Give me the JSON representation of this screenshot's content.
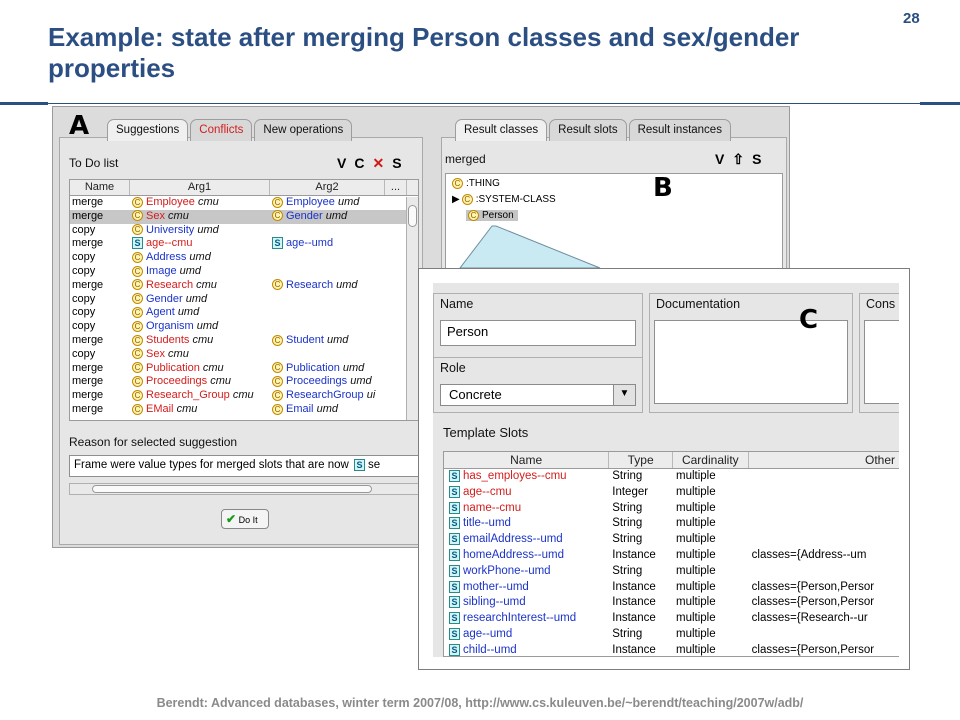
{
  "slide": {
    "title": "Example: state after merging Person classes and sex/gender properties",
    "page_number": "28",
    "footer": "Berendt: Advanced databases, winter term 2007/08, http://www.cs.kuleuven.be/~berendt/teaching/2007w/adb/"
  },
  "colors": {
    "title": "#2b4f82",
    "cmu_red": "#d41d1d",
    "umd_blue": "#1b33c9",
    "selected_row": "#c7c7c7"
  },
  "panel_a": {
    "marker": "A",
    "tabs": [
      "Suggestions",
      "Conflicts",
      "New operations"
    ],
    "active_tab": "Suggestions",
    "todo_label": "To Do list",
    "toolbar_icons": [
      "V",
      "C",
      "✕",
      "S"
    ],
    "columns": [
      "Name",
      "Arg1",
      "Arg2",
      "..."
    ],
    "rows": [
      {
        "op": "merge",
        "a1_icon": "C",
        "a1": "Employee",
        "a1_src": "cmu",
        "a2_icon": "C",
        "a2": "Employee",
        "a2_src": "umd"
      },
      {
        "op": "merge",
        "a1_icon": "C",
        "a1": "Sex",
        "a1_src": "cmu",
        "a2_icon": "C",
        "a2": "Gender",
        "a2_src": "umd",
        "selected": true
      },
      {
        "op": "copy",
        "a1_icon": "C",
        "a1": "University",
        "a1_src": "umd",
        "a2_icon": "",
        "a2": "",
        "a2_src": ""
      },
      {
        "op": "merge",
        "a1_icon": "S",
        "a1": "age--cmu",
        "a1_src": "",
        "a2_icon": "S",
        "a2": "age--umd",
        "a2_src": ""
      },
      {
        "op": "copy",
        "a1_icon": "C",
        "a1": "Address",
        "a1_src": "umd",
        "a2_icon": "",
        "a2": "",
        "a2_src": ""
      },
      {
        "op": "copy",
        "a1_icon": "C",
        "a1": "Image",
        "a1_src": "umd",
        "a2_icon": "",
        "a2": "",
        "a2_src": ""
      },
      {
        "op": "merge",
        "a1_icon": "C",
        "a1": "Research",
        "a1_src": "cmu",
        "a2_icon": "C",
        "a2": "Research",
        "a2_src": "umd"
      },
      {
        "op": "copy",
        "a1_icon": "C",
        "a1": "Gender",
        "a1_src": "umd",
        "a2_icon": "",
        "a2": "",
        "a2_src": ""
      },
      {
        "op": "copy",
        "a1_icon": "C",
        "a1": "Agent",
        "a1_src": "umd",
        "a2_icon": "",
        "a2": "",
        "a2_src": ""
      },
      {
        "op": "copy",
        "a1_icon": "C",
        "a1": "Organism",
        "a1_src": "umd",
        "a2_icon": "",
        "a2": "",
        "a2_src": ""
      },
      {
        "op": "merge",
        "a1_icon": "C",
        "a1": "Students",
        "a1_src": "cmu",
        "a2_icon": "C",
        "a2": "Student",
        "a2_src": "umd"
      },
      {
        "op": "copy",
        "a1_icon": "C",
        "a1": "Sex",
        "a1_src": "cmu",
        "a2_icon": "",
        "a2": "",
        "a2_src": ""
      },
      {
        "op": "merge",
        "a1_icon": "C",
        "a1": "Publication",
        "a1_src": "cmu",
        "a2_icon": "C",
        "a2": "Publication",
        "a2_src": "umd"
      },
      {
        "op": "merge",
        "a1_icon": "C",
        "a1": "Proceedings",
        "a1_src": "cmu",
        "a2_icon": "C",
        "a2": "Proceedings",
        "a2_src": "umd"
      },
      {
        "op": "merge",
        "a1_icon": "C",
        "a1": "Research_Group",
        "a1_src": "cmu",
        "a2_icon": "C",
        "a2": "ResearchGroup",
        "a2_src": "ui"
      },
      {
        "op": "merge",
        "a1_icon": "C",
        "a1": "EMail",
        "a1_src": "cmu",
        "a2_icon": "C",
        "a2": "Email",
        "a2_src": "umd"
      }
    ],
    "reason_label": "Reason for selected suggestion",
    "reason_text": "Frame were value types for merged slots that are now",
    "reason_tail": "se",
    "doit_label": "Do It"
  },
  "panel_b": {
    "marker": "B",
    "tabs": [
      "Result classes",
      "Result slots",
      "Result instances"
    ],
    "active_tab": "Result classes",
    "label": "merged",
    "toolbar_icons": [
      "V",
      "⇧",
      "S"
    ],
    "tree": [
      ":THING",
      ":SYSTEM-CLASS",
      "Person"
    ]
  },
  "panel_c": {
    "marker": "C",
    "name_label": "Name",
    "name_value": "Person",
    "documentation_label": "Documentation",
    "constraints_label": "Cons",
    "role_label": "Role",
    "role_value": "Concrete",
    "template_slots_label": "Template Slots",
    "columns": [
      "Name",
      "Type",
      "Cardinality",
      "Other"
    ],
    "slots": [
      {
        "name": "has_employes--cmu",
        "src": "cmu",
        "type": "String",
        "card": "multiple",
        "other": ""
      },
      {
        "name": "age--cmu",
        "src": "cmu",
        "type": "Integer",
        "card": "multiple",
        "other": ""
      },
      {
        "name": "name--cmu",
        "src": "cmu",
        "type": "String",
        "card": "multiple",
        "other": ""
      },
      {
        "name": "title--umd",
        "src": "umd",
        "type": "String",
        "card": "multiple",
        "other": ""
      },
      {
        "name": "emailAddress--umd",
        "src": "umd",
        "type": "String",
        "card": "multiple",
        "other": ""
      },
      {
        "name": "homeAddress--umd",
        "src": "umd",
        "type": "Instance",
        "card": "multiple",
        "other": "classes={Address--um"
      },
      {
        "name": "workPhone--umd",
        "src": "umd",
        "type": "String",
        "card": "multiple",
        "other": ""
      },
      {
        "name": "mother--umd",
        "src": "umd",
        "type": "Instance",
        "card": "multiple",
        "other": "classes={Person,Persor"
      },
      {
        "name": "sibling--umd",
        "src": "umd",
        "type": "Instance",
        "card": "multiple",
        "other": "classes={Person,Persor"
      },
      {
        "name": "researchInterest--umd",
        "src": "umd",
        "type": "Instance",
        "card": "multiple",
        "other": "classes={Research--ur"
      },
      {
        "name": "age--umd",
        "src": "umd",
        "type": "String",
        "card": "multiple",
        "other": ""
      },
      {
        "name": "child--umd",
        "src": "umd",
        "type": "Instance",
        "card": "multiple",
        "other": "classes={Person,Persor"
      }
    ]
  }
}
